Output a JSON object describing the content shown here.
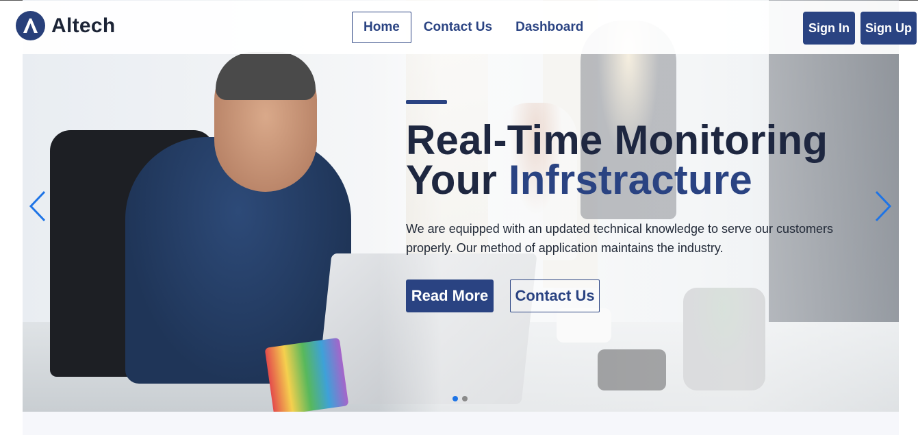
{
  "brand": {
    "name": "Altech",
    "color": "#2a4382"
  },
  "nav": {
    "items": [
      {
        "label": "Home",
        "active": true
      },
      {
        "label": "Contact Us",
        "active": false
      },
      {
        "label": "Dashboard",
        "active": false
      }
    ]
  },
  "auth": {
    "signin_label": "Sign In",
    "signup_label": "Sign Up"
  },
  "hero": {
    "title_line1": "Real-Time Monitoring",
    "title_line2_prefix": "Your",
    "title_line2_accent": "Infrstracture",
    "description": "We are equipped with an updated technical knowledge to serve our customers properly. Our method of application maintains the industry.",
    "primary_button": "Read More",
    "secondary_button": "Contact Us",
    "carousel": {
      "prev_icon": "chevron-left-icon",
      "next_icon": "chevron-right-icon",
      "slide_count": 2,
      "active_slide": 1,
      "indicator_active_color": "#1e74e6",
      "indicator_inactive_color": "#8a8a8a"
    }
  }
}
